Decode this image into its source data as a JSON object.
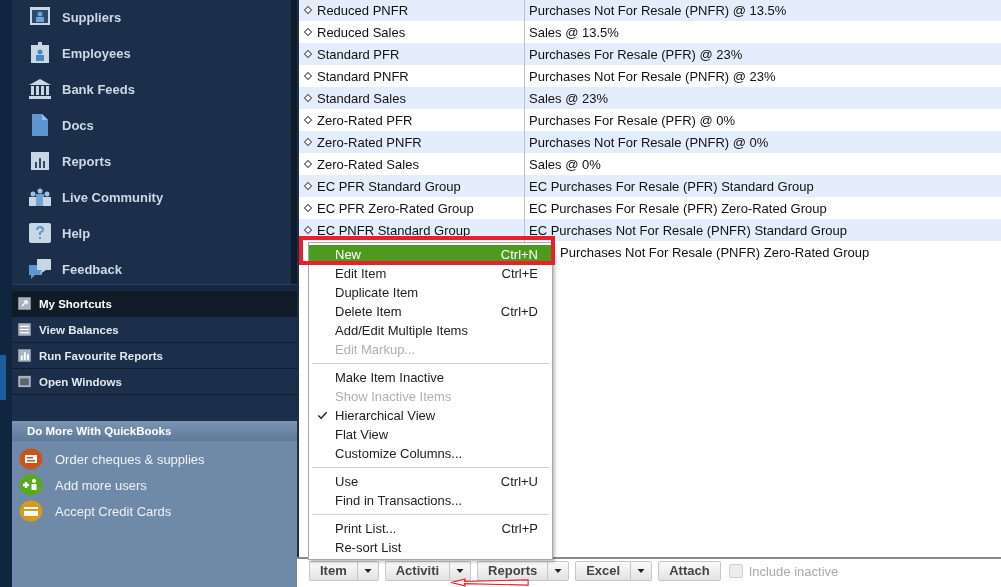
{
  "sidebar": {
    "nav_items": [
      {
        "label": "Suppliers"
      },
      {
        "label": "Employees"
      },
      {
        "label": "Bank Feeds"
      },
      {
        "label": "Docs"
      },
      {
        "label": "Reports"
      },
      {
        "label": "Live Community"
      },
      {
        "label": "Help"
      },
      {
        "label": "Feedback"
      }
    ],
    "sections": [
      {
        "label": "My Shortcuts",
        "selected": true
      },
      {
        "label": "View Balances",
        "selected": false
      },
      {
        "label": "Run Favourite Reports",
        "selected": false
      },
      {
        "label": "Open Windows",
        "selected": false
      }
    ],
    "do_more": {
      "title": "Do More With QuickBooks",
      "items": [
        {
          "label": "Order cheques & supplies",
          "color": "#c8561c"
        },
        {
          "label": "Add more users",
          "color": "#5aa81e"
        },
        {
          "label": "Accept Credit Cards",
          "color": "#d69a1c"
        }
      ]
    }
  },
  "list": {
    "rows": [
      {
        "name": "Reduced PNFR",
        "description": "Purchases Not For Resale (PNFR) @ 13.5%"
      },
      {
        "name": "Reduced Sales",
        "description": "Sales @ 13.5%"
      },
      {
        "name": "Standard PFR",
        "description": "Purchases For Resale (PFR) @ 23%"
      },
      {
        "name": "Standard PNFR",
        "description": "Purchases Not For Resale (PNFR) @ 23%"
      },
      {
        "name": "Standard Sales",
        "description": "Sales @ 23%"
      },
      {
        "name": "Zero-Rated PFR",
        "description": "Purchases For Resale (PFR) @ 0%"
      },
      {
        "name": "Zero-Rated PNFR",
        "description": "Purchases Not For Resale (PNFR) @ 0%"
      },
      {
        "name": "Zero-Rated Sales",
        "description": "Sales @ 0%"
      },
      {
        "name": "EC PFR Standard Group",
        "description": "EC Purchases For Resale (PFR) Standard Group"
      },
      {
        "name": "EC PFR Zero-Rated Group",
        "description": "EC Purchases For Resale (PFR) Zero-Rated Group"
      },
      {
        "name": "EC PNFR Standard Group",
        "description": "EC Purchases Not For Resale (PNFR) Standard Group"
      },
      {
        "description": "Purchases Not For Resale (PNFR) Zero-Rated Group"
      }
    ]
  },
  "menu": {
    "items": [
      {
        "kind": "item",
        "label": "New",
        "shortcut": "Ctrl+N",
        "selected": true,
        "disabled": false,
        "checked": false
      },
      {
        "kind": "item",
        "label": "Edit Item",
        "shortcut": "Ctrl+E",
        "selected": false,
        "disabled": false,
        "checked": false
      },
      {
        "kind": "item",
        "label": "Duplicate Item",
        "selected": false,
        "disabled": false,
        "checked": false
      },
      {
        "kind": "item",
        "label": "Delete Item",
        "shortcut": "Ctrl+D",
        "selected": false,
        "disabled": false,
        "checked": false
      },
      {
        "kind": "item",
        "label": "Add/Edit Multiple Items",
        "selected": false,
        "disabled": false,
        "checked": false
      },
      {
        "kind": "item",
        "label": "Edit Markup...",
        "selected": false,
        "disabled": true,
        "checked": false
      },
      {
        "kind": "separator"
      },
      {
        "kind": "item",
        "label": "Make Item Inactive",
        "selected": false,
        "disabled": false,
        "checked": false
      },
      {
        "kind": "item",
        "label": "Show Inactive Items",
        "selected": false,
        "disabled": true,
        "checked": false
      },
      {
        "kind": "item",
        "label": "Hierarchical View",
        "selected": false,
        "disabled": false,
        "checked": true
      },
      {
        "kind": "item",
        "label": "Flat View",
        "selected": false,
        "disabled": false,
        "checked": false
      },
      {
        "kind": "item",
        "label": "Customize Columns...",
        "selected": false,
        "disabled": false,
        "checked": false
      },
      {
        "kind": "separator"
      },
      {
        "kind": "item",
        "label": "Use",
        "shortcut": "Ctrl+U",
        "selected": false,
        "disabled": false,
        "checked": false
      },
      {
        "kind": "item",
        "label": "Find in Transactions...",
        "selected": false,
        "disabled": false,
        "checked": false
      },
      {
        "kind": "separator"
      },
      {
        "kind": "item",
        "label": "Print List...",
        "shortcut": "Ctrl+P",
        "selected": false,
        "disabled": false,
        "checked": false
      },
      {
        "kind": "item",
        "label": "Re-sort List",
        "selected": false,
        "disabled": false,
        "checked": false
      }
    ]
  },
  "toolbar": {
    "buttons": [
      {
        "kind": "split",
        "label": "Item"
      },
      {
        "kind": "split",
        "label": "Activiti"
      },
      {
        "kind": "split",
        "label": "Reports"
      },
      {
        "kind": "split",
        "label": "Excel"
      },
      {
        "kind": "plain",
        "label": "Attach"
      }
    ],
    "include_inactive": {
      "label": "Include inactive",
      "checked": false,
      "disabled": true
    }
  }
}
